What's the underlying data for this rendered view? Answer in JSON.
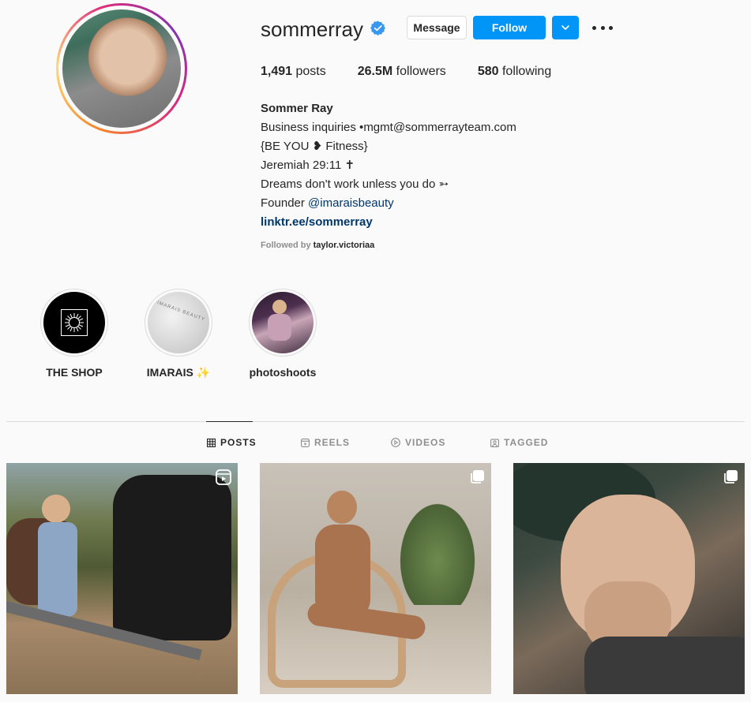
{
  "profile": {
    "username": "sommerray",
    "verified": true,
    "buttons": {
      "message": "Message",
      "follow": "Follow"
    },
    "stats": [
      {
        "value": "1,491",
        "label": "posts"
      },
      {
        "value": "26.5M",
        "label": "followers"
      },
      {
        "value": "580",
        "label": "following"
      }
    ],
    "bio": {
      "name": "Sommer Ray",
      "lines": [
        "Business inquiries •mgmt@sommerrayteam.com",
        "{BE YOU ❥ Fitness}",
        "Jeremiah 29:11 ✝︎",
        "Dreams don't work unless you do ➳"
      ],
      "founder_prefix": "Founder ",
      "founder_mention": "@imaraisbeauty",
      "link": "linktr.ee/sommerray"
    },
    "followed_by": {
      "prefix": "Followed by ",
      "user": "taylor.victoriaa"
    }
  },
  "highlights": [
    {
      "label": "THE SHOP",
      "icon": "sr-logo"
    },
    {
      "label": "IMARAIS ✨",
      "icon": "imarais-product",
      "image_text": "IMARAIS BEAUTY"
    },
    {
      "label": "photoshoots",
      "icon": "photo-thumbnail"
    }
  ],
  "tabs": [
    {
      "label": "POSTS",
      "icon": "grid-icon",
      "active": true
    },
    {
      "label": "REELS",
      "icon": "reels-icon",
      "active": false
    },
    {
      "label": "VIDEOS",
      "icon": "play-icon",
      "active": false
    },
    {
      "label": "TAGGED",
      "icon": "tagged-icon",
      "active": false
    }
  ],
  "posts": [
    {
      "type": "reel",
      "badge": "reels-icon"
    },
    {
      "type": "carousel",
      "badge": "carousel-icon"
    },
    {
      "type": "carousel",
      "badge": "carousel-icon"
    }
  ],
  "colors": {
    "accent": "#0095f6",
    "link": "#00376b",
    "text": "#262626",
    "muted": "#8e8e8e",
    "border": "#dbdbdb",
    "verified": "#3897f0"
  }
}
